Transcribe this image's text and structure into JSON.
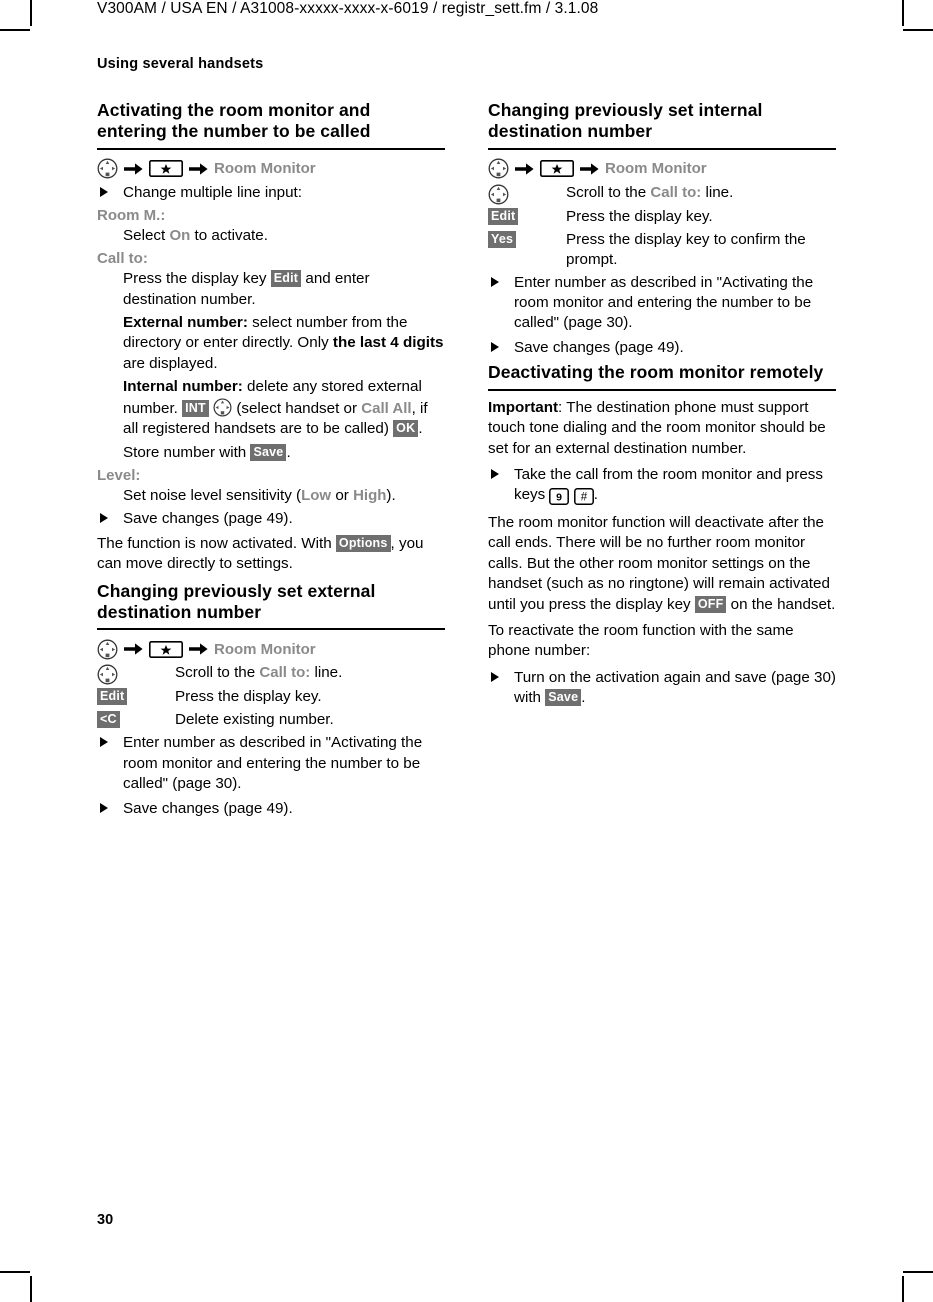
{
  "page": {
    "running_head": "V300AM / USA EN / A31008-xxxxx-xxxx-x-6019 / registr_sett.fm / 3.1.08",
    "section_head": "Using several handsets",
    "folio": "30"
  },
  "icons": {
    "nav": "navigation-key-icon",
    "star": "star-key-icon",
    "hash": "hash-key-icon",
    "digit9": "9",
    "arrow": "right-arrow-icon",
    "bullet": "triangle-bullet-icon"
  },
  "left_column": {
    "section1": {
      "title": "Activating the room monitor and entering the number to be called",
      "nav_path": {
        "menu": "Room Monitor"
      },
      "bullet1": "Change multiple line input:",
      "defs": [
        {
          "label": "Room M.:",
          "body_pre": "Select ",
          "body_menu": "On",
          "body_post": " to activate."
        }
      ],
      "callto_label": "Call to:",
      "callto_line1_pre": "Press the display key ",
      "callto_line1_key": "Edit",
      "callto_line1_post": " and enter destination number.",
      "external_label": "External number:",
      "external_text_a": " select number from the directory or enter directly. Only ",
      "external_bold": "the last 4 digits",
      "external_text_b": " are displayed.",
      "internal_label": "Internal number:",
      "internal_text_a": " delete any stored external number. ",
      "internal_key": "INT",
      "internal_text_b": " (select handset or ",
      "internal_menu": "Call All",
      "internal_text_c": ", if all registered handsets are to be called) ",
      "internal_key2": "OK",
      "internal_text_d": ".",
      "store_pre": "Store number with ",
      "store_key": "Save",
      "store_post": ".",
      "level_label": "Level:",
      "level_pre": "Set noise level sensitivity (",
      "level_low": "Low",
      "level_mid": " or ",
      "level_high": "High",
      "level_post": ").",
      "bullet2": "Save changes (page 49).",
      "closing_pre": "The function is now activated. With ",
      "closing_key": "Options",
      "closing_post": ", you can move directly to settings."
    },
    "section2": {
      "title": "Changing previously set external destination number",
      "nav_path": {
        "menu": "Room Monitor"
      },
      "steps": [
        {
          "slot_type": "navkey",
          "slot_label": "navigation-key-icon",
          "desc_pre": "Scroll to the ",
          "desc_menu": "Call to:",
          "desc_post": " line."
        },
        {
          "slot_type": "key",
          "slot_label": "Edit",
          "desc_pre": "Press the display key.",
          "desc_menu": "",
          "desc_post": ""
        },
        {
          "slot_type": "key",
          "slot_label": "<C",
          "desc_pre": "Delete existing number.",
          "desc_menu": "",
          "desc_post": ""
        }
      ],
      "bullet1": "Enter number as described in \"Activating the room monitor and entering the number to be called\" (page 30).",
      "bullet2": "Save changes (page 49)."
    }
  },
  "right_column": {
    "section1": {
      "title": "Changing previously set internal destination number",
      "nav_path": {
        "menu": "Room Monitor"
      },
      "steps": [
        {
          "slot_type": "navkey",
          "slot_label": "navigation-key-icon",
          "desc_pre": "Scroll to the ",
          "desc_menu": "Call to:",
          "desc_post": " line."
        },
        {
          "slot_type": "key",
          "slot_label": "Edit",
          "desc_pre": "Press the display key.",
          "desc_menu": "",
          "desc_post": ""
        },
        {
          "slot_type": "key",
          "slot_label": "Yes",
          "desc_pre": "Press the display key to confirm the prompt.",
          "desc_menu": "",
          "desc_post": ""
        }
      ],
      "bullet1": "Enter number as described in \"Activating the room monitor and entering the number to be called\" (page 30).",
      "bullet2": "Save changes (page 49)."
    },
    "section2": {
      "title": "Deactivating the room monitor remotely",
      "important_label": "Important",
      "important_text": ": The destination phone must support touch tone dialing and the room monitor should be set for an external destination number.",
      "bullet1_pre": "Take the call from the room monitor and press keys ",
      "bullet1_key1": "9",
      "bullet1_key2": "#",
      "bullet1_post": ".",
      "para_pre": "The room monitor function will deactivate after the call ends. There will be no further room monitor calls. But the other room monitor settings on the handset (such as no ringtone) will remain activated until you press the display key ",
      "para_key": "OFF",
      "para_post": " on the handset.",
      "para2": "To reactivate the room function with the same phone number:",
      "bullet2_pre": "Turn on the activation again and save (page 30) with ",
      "bullet2_key": "Save",
      "bullet2_post": "."
    }
  }
}
